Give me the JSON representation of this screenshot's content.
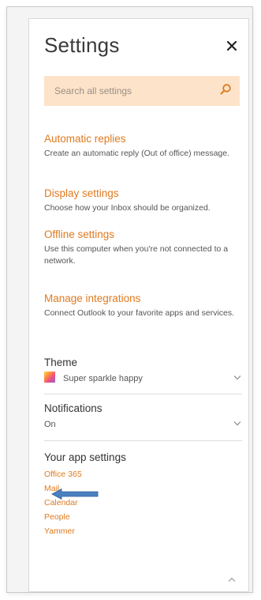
{
  "header": {
    "title": "Settings",
    "close_icon": "close-icon"
  },
  "search": {
    "placeholder": "Search all settings",
    "icon": "search-icon"
  },
  "sections": [
    {
      "title": "Automatic replies",
      "description": "Create an automatic reply (Out of office) message."
    },
    {
      "title": "Display settings",
      "description": "Choose how your Inbox should be organized."
    },
    {
      "title": "Offline settings",
      "description": "Use this computer when you're not connected to a network."
    },
    {
      "title": "Manage integrations",
      "description": "Connect Outlook to your favorite apps and services."
    }
  ],
  "theme": {
    "label": "Theme",
    "value": "Super sparkle happy"
  },
  "notifications": {
    "label": "Notifications",
    "value": "On"
  },
  "app_settings": {
    "label": "Your app settings",
    "links": [
      "Office 365",
      "Mail",
      "Calendar",
      "People",
      "Yammer"
    ]
  },
  "colors": {
    "accent": "#e07a1f",
    "search_bg": "#fde3c9",
    "annotation_arrow": "#4a7fc1"
  }
}
